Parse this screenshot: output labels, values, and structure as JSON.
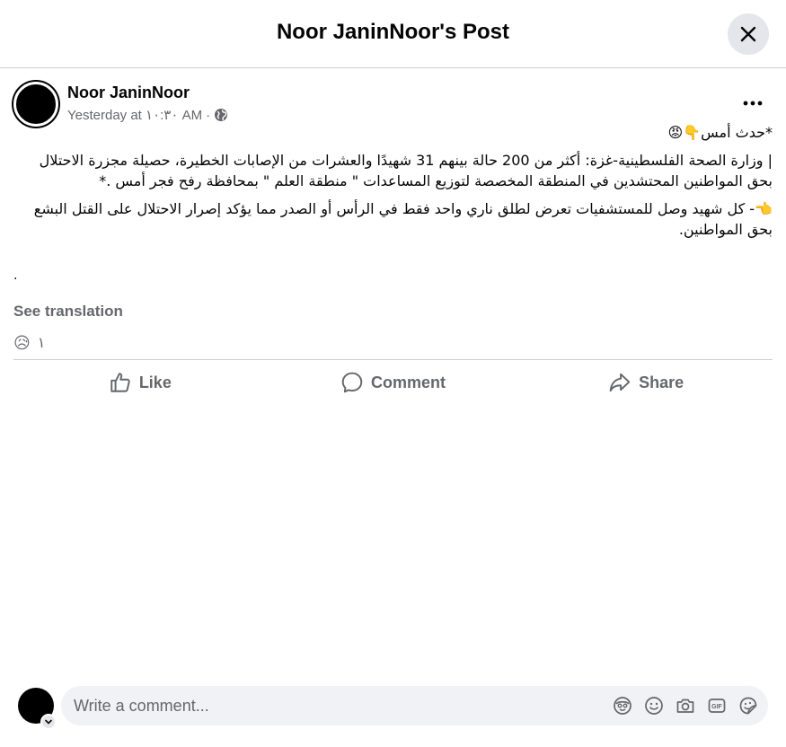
{
  "header": {
    "title": "Noor JaninNoor's Post"
  },
  "post": {
    "author": "Noor JaninNoor",
    "time": "Yesterday at ١٠:٣٠ AM",
    "separator": "·",
    "paragraphs": [
      "*حدث أمس👇😡",
      "| وزارة الصحة الفلسطينية-غزة: أكثر من  200 حالة بينهم 31 شهيدًا والعشرات من الإصابات الخطيرة، حصيلة مجزرة الاحتلال بحق المواطنين المحتشدين في المنطقة المخصصة لتوزيع المساعدات \" منطقة العلم \"  بمحافظة رفح فجر أمس .*",
      "👈- كل شهيد وصل للمستشفيات تعرض لطلق ناري واحد فقط في الرأس أو الصدر مما يؤكد إصرار الاحتلال على القتل البشع بحق المواطنين."
    ],
    "trailing": ".",
    "see_translation": "See translation",
    "reaction_emoji": "😥",
    "reaction_count": "١"
  },
  "actions": {
    "like": "Like",
    "comment": "Comment",
    "share": "Share"
  },
  "composer": {
    "placeholder": "Write a comment..."
  },
  "icons": {
    "close": "close-icon",
    "more": "more-dots-icon",
    "globe": "globe-icon",
    "like": "thumbs-up-icon",
    "comment": "comment-bubble-icon",
    "share": "share-arrow-icon",
    "avatar_sticker": "avatar-sticker-icon",
    "emoji": "smiley-icon",
    "camera": "camera-icon",
    "gif": "gif-icon",
    "sticker": "sticker-icon",
    "chevron": "chevron-down-icon"
  },
  "colors": {
    "text": "#050505",
    "secondary": "#65676b",
    "divider": "#ced0d4",
    "input_bg": "#f0f2f5"
  }
}
